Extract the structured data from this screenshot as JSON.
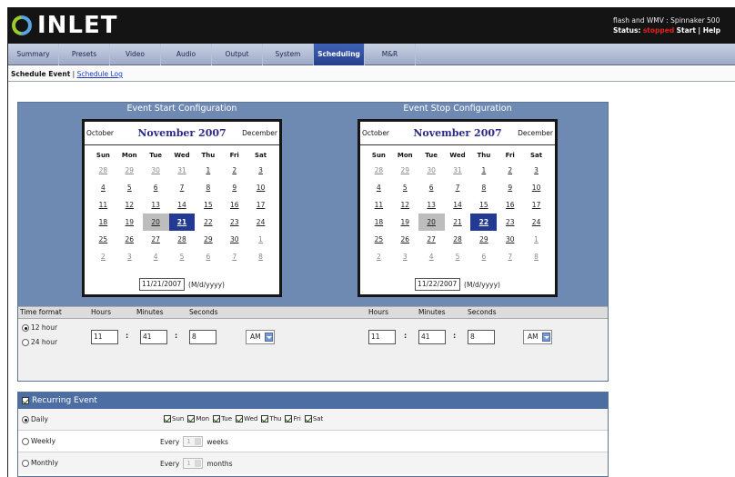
{
  "app": {
    "brand": "INLET",
    "status_line1": "flash and WMV : Spinnaker 500",
    "status_label": "Status:",
    "status_value": "stopped",
    "start_link": "Start",
    "help_link": "| Help"
  },
  "nav": {
    "tabs": [
      {
        "label": "Summary"
      },
      {
        "label": "Presets"
      },
      {
        "label": "Video"
      },
      {
        "label": "Audio"
      },
      {
        "label": "Output"
      },
      {
        "label": "System"
      },
      {
        "label": "Scheduling",
        "active": true
      },
      {
        "label": "M&R"
      }
    ]
  },
  "subnav": {
    "current": "Schedule Event",
    "separator": "|",
    "link": "Schedule Log"
  },
  "start": {
    "title": "Event Start Configuration",
    "prev_month": "October",
    "month": "November 2007",
    "next_month": "December",
    "date_value": "11/21/2007",
    "date_format": "(M/d/yyyy)",
    "hour": "11",
    "minute": "41",
    "second": "8",
    "ampm": "AM"
  },
  "stop": {
    "title": "Event Stop Configuration",
    "prev_month": "October",
    "month": "November 2007",
    "next_month": "December",
    "date_value": "11/22/2007",
    "date_format": "(M/d/yyyy)",
    "hour": "11",
    "minute": "41",
    "second": "8",
    "ampm": "AM"
  },
  "calendar": {
    "day_headers": [
      "Sun",
      "Mon",
      "Tue",
      "Wed",
      "Thu",
      "Fri",
      "Sat"
    ],
    "days": [
      "28",
      "29",
      "30",
      "31",
      "1",
      "2",
      "3",
      "4",
      "5",
      "6",
      "7",
      "8",
      "9",
      "10",
      "11",
      "12",
      "13",
      "14",
      "15",
      "16",
      "17",
      "18",
      "19",
      "20",
      "21",
      "22",
      "23",
      "24",
      "25",
      "26",
      "27",
      "28",
      "29",
      "30",
      "1",
      "2",
      "3",
      "4",
      "5",
      "6",
      "7",
      "8"
    ]
  },
  "time": {
    "format_label": "Time format",
    "hours_label": "Hours",
    "minutes_label": "Minutes",
    "seconds_label": "Seconds",
    "colon": ":",
    "opt_12": "12 hour",
    "opt_24": "24 hour"
  },
  "recurring": {
    "title": "Recurring Event",
    "daily": "Daily",
    "weekly": "Weekly",
    "monthly": "Monthly",
    "days": [
      "Sun",
      "Mon",
      "Tue",
      "Wed",
      "Thu",
      "Fri",
      "Sat"
    ],
    "every": "Every",
    "interval_value": "1",
    "weeks": "weeks",
    "months": "months"
  }
}
